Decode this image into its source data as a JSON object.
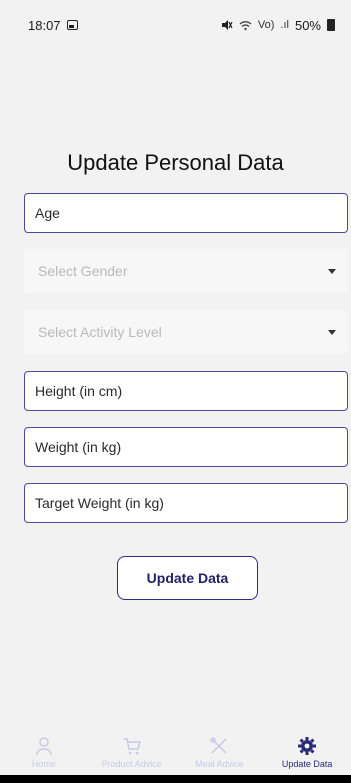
{
  "status_bar": {
    "time": "18:07",
    "battery": "50%",
    "network": "Vo)",
    "signal": ".ıl"
  },
  "page": {
    "title": "Update Personal Data"
  },
  "form": {
    "age_placeholder": "Age",
    "gender_placeholder": "Select Gender",
    "activity_placeholder": "Select Activity Level",
    "height_placeholder": "Height (in cm)",
    "weight_placeholder": "Weight (in kg)",
    "target_weight_placeholder": "Target Weight (in kg)",
    "submit_label": "Update Data"
  },
  "tabs": [
    {
      "label": "Home",
      "icon": "person-icon",
      "active": false
    },
    {
      "label": "Product Advice",
      "icon": "cart-icon",
      "active": false
    },
    {
      "label": "Meal Advice",
      "icon": "utensils-icon",
      "active": false
    },
    {
      "label": "Update Data",
      "icon": "gear-icon",
      "active": true
    }
  ],
  "colors": {
    "accent": "#2b2b7a",
    "field_border": "#4a4a9c",
    "inactive_tab": "#c9c9e6",
    "background": "#f2f2f2"
  }
}
